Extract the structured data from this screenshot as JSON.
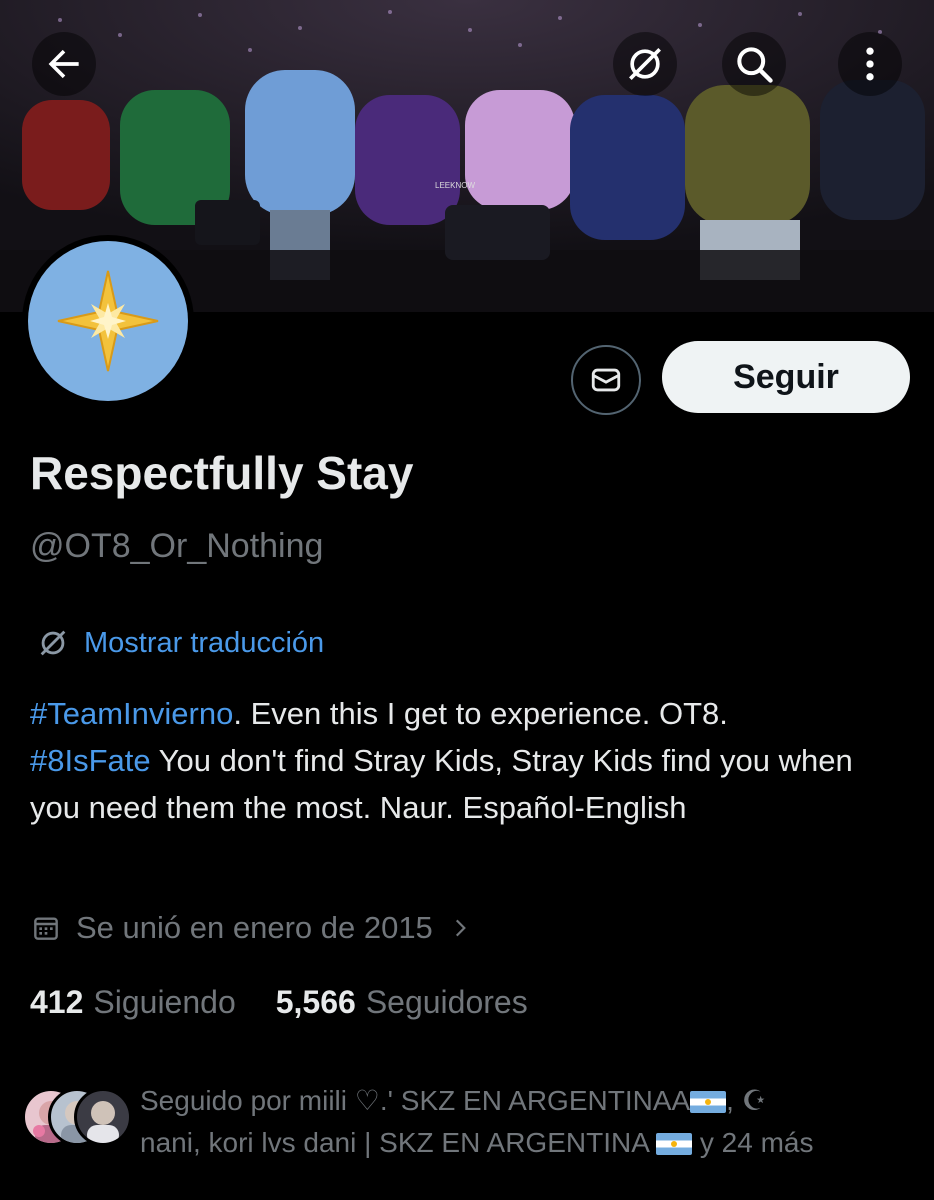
{
  "header": {
    "back_icon": "arrow-left-icon",
    "translate_icon": "translate-icon",
    "search_icon": "search-icon",
    "more_icon": "more-vertical-icon",
    "banner_watermark": "LEEKNOW"
  },
  "profile": {
    "display_name": "Respectfully Stay",
    "handle": "@OT8_Or_Nothing",
    "avatar_icon": "compass-star-icon",
    "message_icon": "envelope-icon",
    "follow_label": "Seguir",
    "translate_label": "Mostrar traducción",
    "bio": {
      "tag1": "#TeamInvierno",
      "text1": ". Even this I get to experience. OT8.",
      "tag2": "#8IsFate",
      "text2": "  You don't find Stray Kids, Stray Kids find you when you need them the most.  Naur. Español-English"
    },
    "joined": "Se unió en enero de 2015",
    "following_count": "412",
    "following_label": "Siguiendo",
    "followers_count": "5,566",
    "followers_label": "Seguidores",
    "followed_by": {
      "part1": "Seguido por miili ♡.' SKZ EN ARGENTINAA",
      "part2": ", ☪",
      "part3": "nani, kori lvs dani | SKZ EN ARGENTINA ",
      "part4": " y 24 más"
    }
  },
  "colors": {
    "background": "#000000",
    "link": "#4a99e9",
    "muted": "#71767b",
    "text": "#e7e9ea",
    "avatar_bg": "#7fb1e3"
  }
}
